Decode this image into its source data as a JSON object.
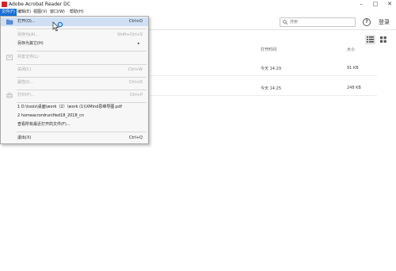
{
  "window": {
    "title": "Adobe Acrobat Reader DC",
    "minimize": "–",
    "maximize": "□",
    "close": "✕"
  },
  "menubar": {
    "items": [
      {
        "label": "文件(F)"
      },
      {
        "label": "编辑(E)"
      },
      {
        "label": "视图(V)"
      },
      {
        "label": "窗口(W)"
      },
      {
        "label": "帮助(H)"
      }
    ]
  },
  "toolbar": {
    "search_placeholder": "搜索",
    "help": "?",
    "login": "登录"
  },
  "file_list": {
    "headers": {
      "opened": "打开时间",
      "size": "大小"
    },
    "rows": [
      {
        "opened": "今天 14:29",
        "size": "91 KB"
      },
      {
        "opened": "今天 14:25",
        "size": "248 KB"
      }
    ]
  },
  "file_menu": {
    "open": {
      "label": "打开(O)...",
      "shortcut": "Ctrl+O"
    },
    "save_as": {
      "label": "另存为(A)...",
      "shortcut": "Shift+Ctrl+S"
    },
    "save_as_other": {
      "label": "另存为其它(H)",
      "arrow": "▸"
    },
    "share": {
      "label": "共享文件(L)"
    },
    "close": {
      "label": "关闭(C)",
      "shortcut": "Ctrl+W"
    },
    "properties": {
      "label": "属性(I)...",
      "shortcut": "Ctrl+D"
    },
    "print": {
      "label": "打印(P)...",
      "shortcut": "Ctrl+P"
    },
    "recent": [
      {
        "label": "1 D:\\tools\\桌面\\work（2）\\work (1)\\XMind思维导图.pdf"
      },
      {
        "label": "2 homeacrordrunified18_2018_cn"
      }
    ],
    "view_all_recent": {
      "label": "查看所有最近打开的文件(F)..."
    },
    "exit": {
      "label": "退出(X)",
      "shortcut": "Ctrl+Q"
    }
  },
  "colors": {
    "menu_active": "#1a6fd6",
    "brand_red": "#d4232b",
    "hover": "#cfe0f5"
  }
}
